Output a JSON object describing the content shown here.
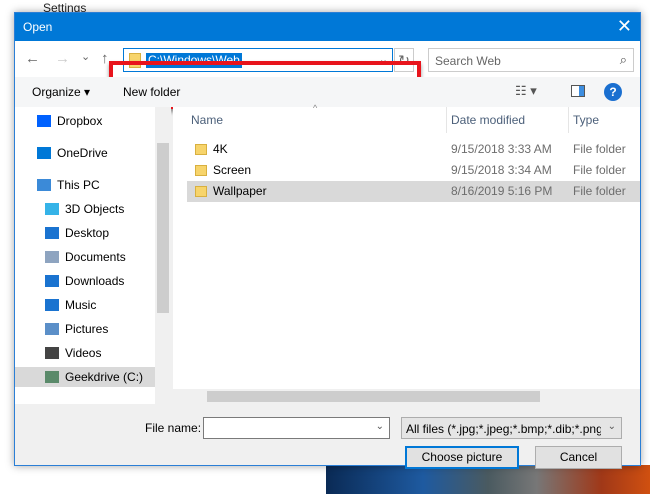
{
  "background": {
    "window_title": "Settings"
  },
  "dialog": {
    "title": "Open",
    "close": "✕"
  },
  "nav": {
    "back": "←",
    "forward": "→",
    "recent": "⌄",
    "up": "↑",
    "address": "C:\\Windows\\Web",
    "refresh": "↻",
    "search_placeholder": "Search Web",
    "search_icon": "⌕"
  },
  "toolbar": {
    "organize": "Organize ▾",
    "new_folder": "New folder",
    "view": "☷ ▾",
    "help": "?"
  },
  "sidebar": {
    "items": [
      {
        "label": "Dropbox",
        "icon": "dropbox-icon",
        "color": "#0061fe"
      },
      {
        "label": "OneDrive",
        "icon": "onedrive-icon",
        "color": "#0078d7"
      },
      {
        "label": "This PC",
        "icon": "pc-icon",
        "color": "#3b8ad8"
      },
      {
        "label": "3D Objects",
        "icon": "cube-icon",
        "color": "#35b3e8"
      },
      {
        "label": "Desktop",
        "icon": "desktop-icon",
        "color": "#1a73d0"
      },
      {
        "label": "Documents",
        "icon": "documents-icon",
        "color": "#8ea4c0"
      },
      {
        "label": "Downloads",
        "icon": "downloads-icon",
        "color": "#1a73d0"
      },
      {
        "label": "Music",
        "icon": "music-icon",
        "color": "#1a73d0"
      },
      {
        "label": "Pictures",
        "icon": "pictures-icon",
        "color": "#5b8fc8"
      },
      {
        "label": "Videos",
        "icon": "videos-icon",
        "color": "#444"
      },
      {
        "label": "Geekdrive (C:)",
        "icon": "drive-icon",
        "color": "#5a8a6a"
      }
    ]
  },
  "files": {
    "headers": {
      "name": "Name",
      "date": "Date modified",
      "type": "Type"
    },
    "rows": [
      {
        "name": "4K",
        "date": "9/15/2018 3:33 AM",
        "type": "File folder"
      },
      {
        "name": "Screen",
        "date": "9/15/2018 3:34 AM",
        "type": "File folder"
      },
      {
        "name": "Wallpaper",
        "date": "8/16/2019 5:16 PM",
        "type": "File folder"
      }
    ]
  },
  "footer": {
    "file_name_label": "File name:",
    "file_name_value": "",
    "file_type": "All files (*.jpg;*.jpeg;*.bmp;*.dib;*.png",
    "choose": "Choose picture",
    "cancel": "Cancel"
  }
}
